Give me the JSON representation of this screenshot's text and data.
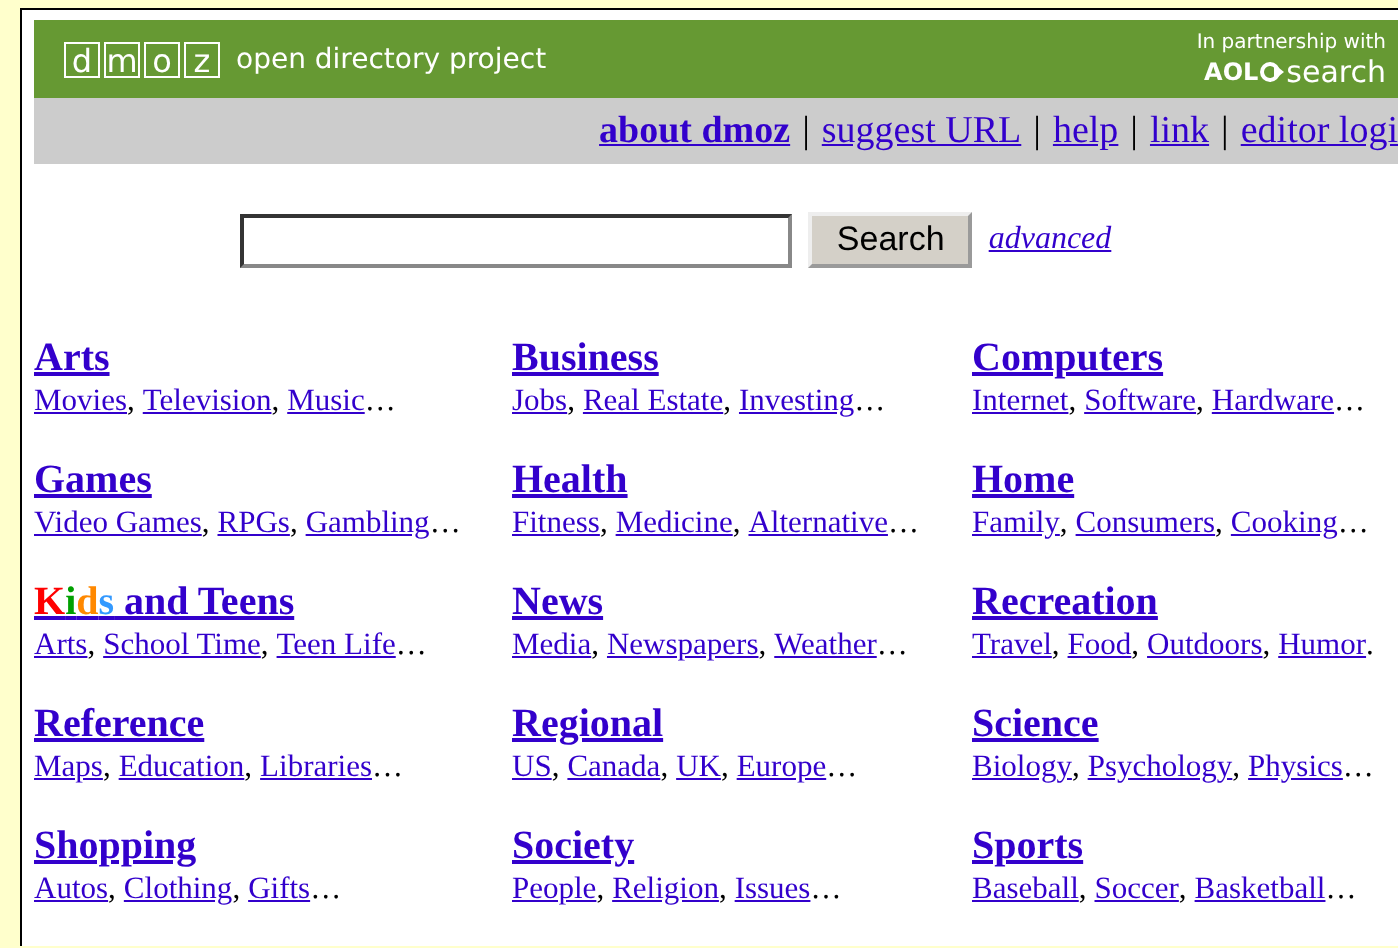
{
  "header": {
    "logo_letters": [
      "d",
      "m",
      "o",
      "z"
    ],
    "tagline": "open directory project",
    "partner_text": "In partnership with",
    "partner_brand": "AOL",
    "partner_product": "search"
  },
  "nav": [
    {
      "label": "about dmoz",
      "bold": true,
      "separator": "|"
    },
    {
      "label": "suggest URL",
      "bold": false,
      "separator": "|"
    },
    {
      "label": "help",
      "bold": false,
      "separator": "|"
    },
    {
      "label": "link",
      "bold": false,
      "separator": "|"
    },
    {
      "label": "editor logi",
      "bold": false
    }
  ],
  "search": {
    "button": "Search",
    "advanced": "advanced"
  },
  "categories": [
    {
      "title_parts": [
        {
          "text": "Arts"
        }
      ],
      "subcategories": [
        {
          "label": "Movies",
          "suffix": ","
        },
        {
          "label": "Television",
          "suffix": ","
        },
        {
          "label": "Music",
          "suffix": "…"
        }
      ]
    },
    {
      "title_parts": [
        {
          "text": "Business"
        }
      ],
      "subcategories": [
        {
          "label": "Jobs",
          "suffix": ","
        },
        {
          "label": "Real Estate",
          "suffix": ","
        },
        {
          "label": "Investing",
          "suffix": "…"
        }
      ]
    },
    {
      "title_parts": [
        {
          "text": "Computers"
        }
      ],
      "subcategories": [
        {
          "label": "Internet",
          "suffix": ","
        },
        {
          "label": "Software",
          "suffix": ","
        },
        {
          "label": "Hardware",
          "suffix": "…"
        }
      ]
    },
    {
      "title_parts": [
        {
          "text": "Games"
        }
      ],
      "subcategories": [
        {
          "label": "Video Games",
          "suffix": ","
        },
        {
          "label": "RPGs",
          "suffix": ","
        },
        {
          "label": "Gambling",
          "suffix": "…"
        }
      ]
    },
    {
      "title_parts": [
        {
          "text": "Health"
        }
      ],
      "subcategories": [
        {
          "label": "Fitness",
          "suffix": ","
        },
        {
          "label": "Medicine",
          "suffix": ","
        },
        {
          "label": "Alternative",
          "suffix": "…"
        }
      ]
    },
    {
      "title_parts": [
        {
          "text": "Home"
        }
      ],
      "subcategories": [
        {
          "label": "Family",
          "suffix": ","
        },
        {
          "label": "Consumers",
          "suffix": ","
        },
        {
          "label": "Cooking",
          "suffix": "…"
        }
      ]
    },
    {
      "title_parts": [
        {
          "text": "K",
          "color": "#ff0000"
        },
        {
          "text": "i",
          "color": "#00a000"
        },
        {
          "text": "d",
          "color": "#ff8800"
        },
        {
          "text": "s",
          "color": "#3399ff"
        },
        {
          "text": " and Teens"
        }
      ],
      "subcategories": [
        {
          "label": "Arts",
          "suffix": ","
        },
        {
          "label": "School Time",
          "suffix": ","
        },
        {
          "label": "Teen Life",
          "suffix": "…"
        }
      ]
    },
    {
      "title_parts": [
        {
          "text": "News"
        }
      ],
      "subcategories": [
        {
          "label": "Media",
          "suffix": ","
        },
        {
          "label": "Newspapers",
          "suffix": ","
        },
        {
          "label": "Weather",
          "suffix": "…"
        }
      ]
    },
    {
      "title_parts": [
        {
          "text": "Recreation"
        }
      ],
      "subcategories": [
        {
          "label": "Travel",
          "suffix": ","
        },
        {
          "label": "Food",
          "suffix": ","
        },
        {
          "label": "Outdoors",
          "suffix": ","
        },
        {
          "label": "Humor",
          "suffix": "."
        }
      ]
    },
    {
      "title_parts": [
        {
          "text": "Reference"
        }
      ],
      "subcategories": [
        {
          "label": "Maps",
          "suffix": ","
        },
        {
          "label": "Education",
          "suffix": ","
        },
        {
          "label": "Libraries",
          "suffix": "…"
        }
      ]
    },
    {
      "title_parts": [
        {
          "text": "Regional"
        }
      ],
      "subcategories": [
        {
          "label": "US",
          "suffix": ","
        },
        {
          "label": "Canada",
          "suffix": ","
        },
        {
          "label": "UK",
          "suffix": ","
        },
        {
          "label": "Europe",
          "suffix": "…"
        }
      ]
    },
    {
      "title_parts": [
        {
          "text": "Science"
        }
      ],
      "subcategories": [
        {
          "label": "Biology",
          "suffix": ","
        },
        {
          "label": "Psychology",
          "suffix": ","
        },
        {
          "label": "Physics",
          "suffix": "…"
        }
      ]
    },
    {
      "title_parts": [
        {
          "text": "Shopping"
        }
      ],
      "subcategories": [
        {
          "label": "Autos",
          "suffix": ","
        },
        {
          "label": "Clothing",
          "suffix": ","
        },
        {
          "label": "Gifts",
          "suffix": "…"
        }
      ]
    },
    {
      "title_parts": [
        {
          "text": "Society"
        }
      ],
      "subcategories": [
        {
          "label": "People",
          "suffix": ","
        },
        {
          "label": "Religion",
          "suffix": ","
        },
        {
          "label": "Issues",
          "suffix": "…"
        }
      ]
    },
    {
      "title_parts": [
        {
          "text": "Sports"
        }
      ],
      "subcategories": [
        {
          "label": "Baseball",
          "suffix": ","
        },
        {
          "label": "Soccer",
          "suffix": ","
        },
        {
          "label": "Basketball",
          "suffix": "…"
        }
      ]
    }
  ]
}
